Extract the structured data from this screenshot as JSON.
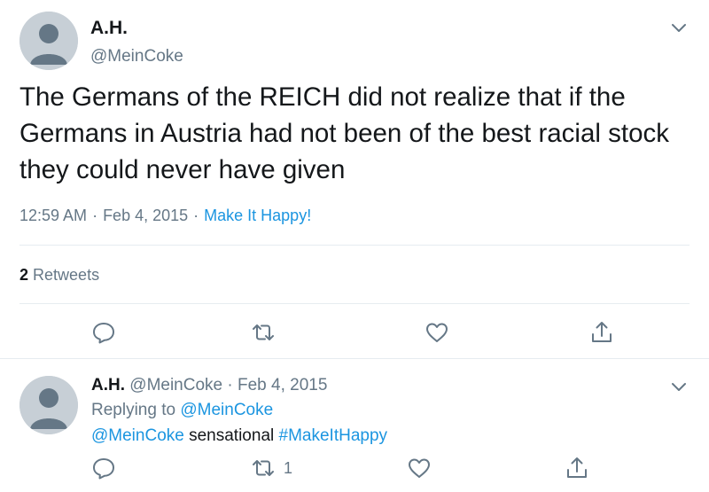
{
  "main_tweet": {
    "display_name": "A.H.",
    "handle": "@MeinCoke",
    "text": "The Germans of the REICH did not realize that if the Germans in Austria had not been of the best racial stock they could never have given",
    "time": "12:59 AM",
    "date": "Feb 4, 2015",
    "source": "Make It Happy!",
    "separator": "·",
    "retweet_count": "2",
    "retweet_label": "Retweets"
  },
  "reply_tweet": {
    "display_name": "A.H.",
    "handle": "@MeinCoke",
    "date": "Feb 4, 2015",
    "separator": "·",
    "replying_prefix": "Replying to",
    "replying_handle": "@MeinCoke",
    "mention": "@MeinCoke",
    "text": " sensational ",
    "hashtag": "#MakeItHappy",
    "retweet_count": "1"
  },
  "icons": {
    "avatar": "default-avatar-icon",
    "caret": "chevron-down-icon",
    "reply": "reply-icon",
    "retweet": "retweet-icon",
    "like": "heart-icon",
    "share": "share-icon"
  },
  "colors": {
    "link": "#1b95e0",
    "secondary_text": "#657786",
    "primary_text": "#14171a",
    "divider": "#e6ecf0",
    "avatar_bg": "#c7cfd6",
    "avatar_fg": "#657786"
  }
}
